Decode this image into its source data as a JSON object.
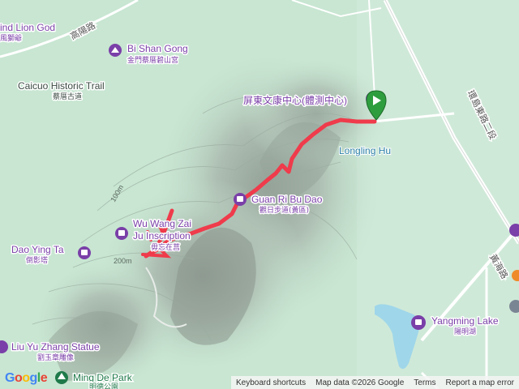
{
  "map": {
    "route_color": "#ef3b4b",
    "water_color": "#9fd6ea",
    "poi_color": "#7a3fa8",
    "start_marker_color": "#2e9d3e",
    "labels": {
      "lion_god": "ind Lion God",
      "lion_god_sub": "風獅爺",
      "gaoyang_road": "高陽路",
      "bi_shan_gong": "Bi Shan Gong",
      "bi_shan_gong_sub": "金門蔡厝碧山宮",
      "caicuo_trail": "Caicuo Historic Trail",
      "caicuo_trail_sub": "蔡厝古道",
      "pingdong_center": "屏東文康中心(體測中心)",
      "longling_hu": "Longling Hu",
      "huandao_road": "環島東路二段",
      "guan_ri_bu_dao": "Guan Ri Bu Dao",
      "guan_ri_bu_dao_sub": "觀日步道(黃區)",
      "wu_wang": "Wu Wang Zai",
      "wu_wang_2": "Ju Inscription",
      "wu_wang_sub": "毋忘在莒",
      "dao_ying_ta": "Dao Ying Ta",
      "dao_ying_ta_sub": "倒影塔",
      "liu_yu_zhang": "Liu Yu Zhang Statue",
      "liu_yu_zhang_sub": "劉玉章雕像",
      "ming_de_park": "Ming De Park",
      "ming_de_park_sub": "明德公園",
      "huanghai_road": "黃海路",
      "yangming_lake": "Yangming Lake",
      "yangming_lake_sub": "陽明湖",
      "contour_100": "100m",
      "contour_200": "200m"
    },
    "icons": [
      "poi-temple-icon",
      "poi-landmark-icon",
      "park-tree-icon",
      "start-flag-marker-icon"
    ]
  },
  "google_logo": "Google",
  "attribution": {
    "keyboard": "Keyboard shortcuts",
    "map_data": "Map data ©2026 Google",
    "terms": "Terms",
    "report": "Report a map error"
  }
}
